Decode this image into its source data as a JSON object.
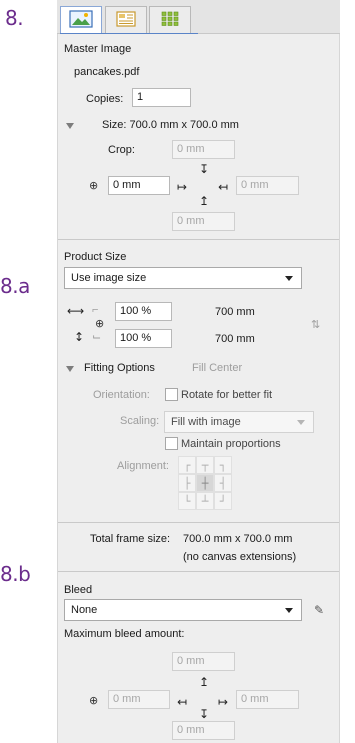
{
  "markers": {
    "m8": "8.",
    "m8a": "8.a",
    "m8b": "8.b"
  },
  "tabs": [
    {
      "icon": "image-frame-icon"
    },
    {
      "icon": "layout-icon"
    },
    {
      "icon": "grid-icon"
    }
  ],
  "master_image": {
    "heading": "Master Image",
    "file_name": "pancakes.pdf",
    "copies_label": "Copies:",
    "copies_value": "1",
    "size_text": "Size: 700.0 mm x 700.0 mm",
    "crop_label": "Crop:",
    "crop_top": "0 mm",
    "crop_left": "0 mm",
    "crop_right": "0 mm",
    "crop_bottom": "0 mm"
  },
  "product_size": {
    "heading": "Product Size",
    "mode_select": "Use image size",
    "width_pct": "100 %",
    "height_pct": "100 %",
    "width_mm": "700 mm",
    "height_mm": "700 mm",
    "fitting_label": "Fitting Options",
    "fitting_value": "Fill Center",
    "orientation_label": "Orientation:",
    "rotate_label": "Rotate for better fit",
    "scaling_label": "Scaling:",
    "scaling_value": "Fill with image",
    "maintain_label": "Maintain proportions",
    "alignment_label": "Alignment:"
  },
  "frame": {
    "total_label": "Total frame size:",
    "total_value": "700.0 mm x 700.0 mm",
    "note": "(no canvas extensions)"
  },
  "bleed": {
    "heading": "Bleed",
    "select_value": "None",
    "max_label": "Maximum bleed amount:",
    "top": "0 mm",
    "left": "0 mm",
    "right": "0 mm",
    "bottom": "0 mm"
  },
  "colors": {
    "marker": "#6b2c8c",
    "accent_blue": "#5a84c8"
  }
}
